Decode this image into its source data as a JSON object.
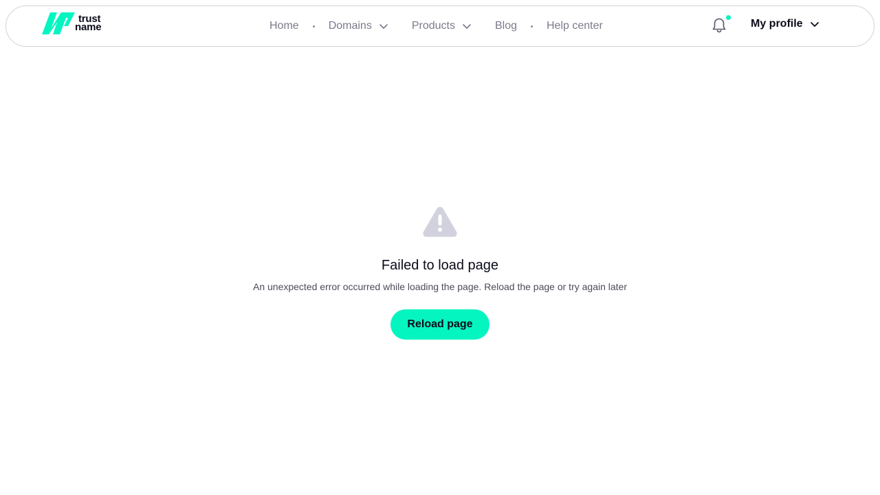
{
  "header": {
    "logo": {
      "line1": "trust",
      "line2": "name"
    },
    "nav": {
      "home": "Home",
      "domains": "Domains",
      "products": "Products",
      "blog": "Blog",
      "help": "Help center"
    },
    "profile_label": "My profile",
    "notification_badge": true
  },
  "error": {
    "title": "Failed to load page",
    "message": "An unexpected error occurred while loading the page. Reload the page or try again later",
    "button_label": "Reload page"
  },
  "colors": {
    "accent": "#05f5c1",
    "text_dark": "#0b0b1a",
    "nav_text": "#7a7a8a",
    "icon_muted": "#d2d2de"
  },
  "icons": {
    "logo": "trustname-mark-icon",
    "notifications": "bell-icon",
    "dropdown": "chevron-down-icon",
    "error": "warning-triangle-icon"
  }
}
